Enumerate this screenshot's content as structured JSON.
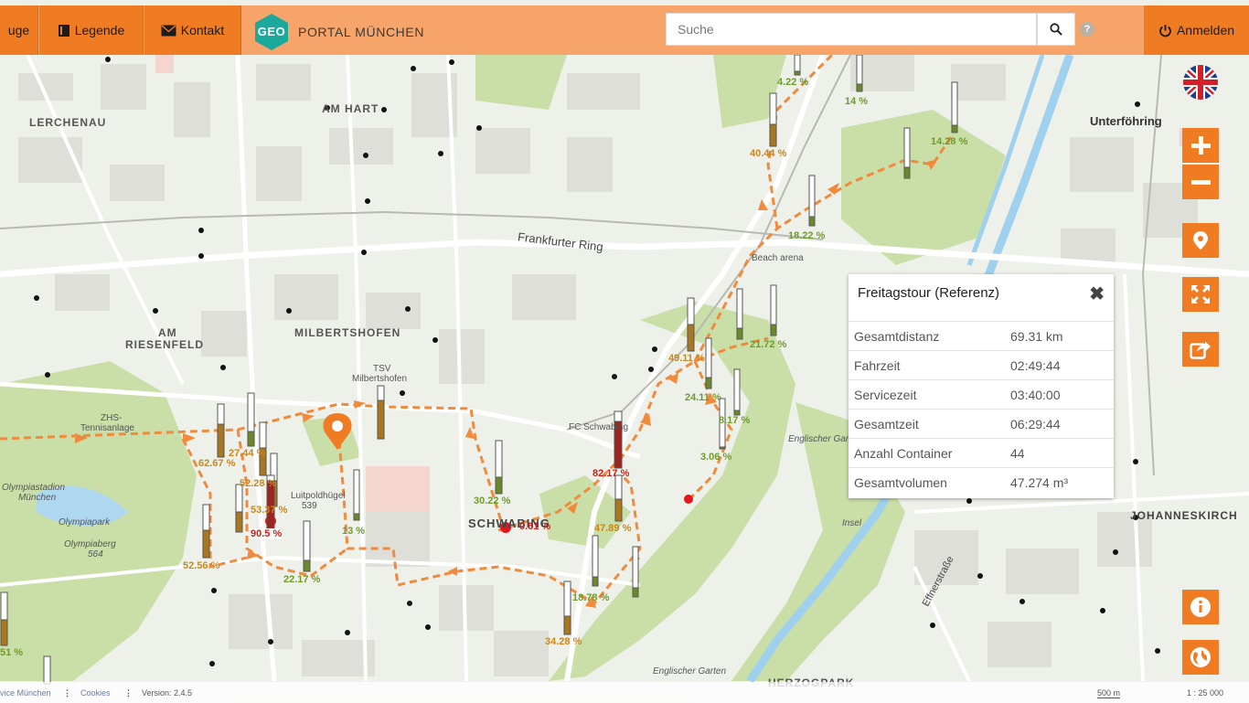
{
  "topbar": {
    "tools_label": "uge",
    "legend_label": "Legende",
    "contact_label": "Kontakt",
    "brand_badge": "GEO",
    "brand_name": "PORTAL MÜNCHEN",
    "search_placeholder": "Suche",
    "help_symbol": "?",
    "login_label": "Anmelden"
  },
  "colors": {
    "accent": "#ef7b22",
    "bar": "#f7a46a",
    "brand_teal": "#1ba99b",
    "route": "#f08a3c"
  },
  "map": {
    "district_labels": [
      "LERCHENAU",
      "AM HART",
      "AM",
      "RIESENFELD",
      "MILBERTSHOFEN",
      "SCHWABING",
      "Unterföhring",
      "JOHANNESKIRCH",
      "HERZOGPARK"
    ],
    "street_labels": [
      "Frankfurter Ring",
      "Effnerstraße"
    ],
    "poi_labels": [
      "TSV",
      "Milbertshofen",
      "ZHS-",
      "Tennisanlage",
      "Olympiastadion",
      "München",
      "Olympiapark",
      "Olympiaberg",
      "564",
      "Luitpoldhügel",
      "539",
      "FC Schwabing",
      "Beach arena",
      "Englischer Garten",
      "Insel"
    ],
    "fill_levels": [
      "4.22 %",
      "14 %",
      "14.28 %",
      "40.44 %",
      "18.22 %",
      "21.72 %",
      "49.11 %",
      "24.11 %",
      "8.17 %",
      "3.06 %",
      "27.44 %",
      "62.67 %",
      "52.28 %",
      "53.37 %",
      "90.5 %",
      "13 %",
      "30.22 %",
      "0.61 %",
      "82.17 %",
      "47.89 %",
      "18.78 %",
      "34.28 %",
      "52.56 %",
      "22.17 %",
      "51 %"
    ]
  },
  "popup": {
    "title": "Freitagstour (Referenz)",
    "close_symbol": "✖",
    "rows": [
      {
        "label": "Gesamtdistanz",
        "value": "69.31 km"
      },
      {
        "label": "Fahrzeit",
        "value": "02:49:44"
      },
      {
        "label": "Servicezeit",
        "value": "03:40:00"
      },
      {
        "label": "Gesamtzeit",
        "value": "06:29:44"
      },
      {
        "label": "Anzahl Container",
        "value": "44"
      },
      {
        "label": "Gesamtvolumen",
        "value": "47.274 m³"
      }
    ]
  },
  "controls": {
    "zoom_in": "zoom-in",
    "zoom_out": "zoom-out",
    "location": "marker",
    "fullscreen": "expand",
    "share": "share",
    "info": "info",
    "globe": "globe"
  },
  "footer": {
    "imprint": "vice München",
    "cookies": "Cookies",
    "version": "Version: 2.4.5",
    "scale_length": "500 m",
    "scale_ratio": "1 : 25 000"
  }
}
